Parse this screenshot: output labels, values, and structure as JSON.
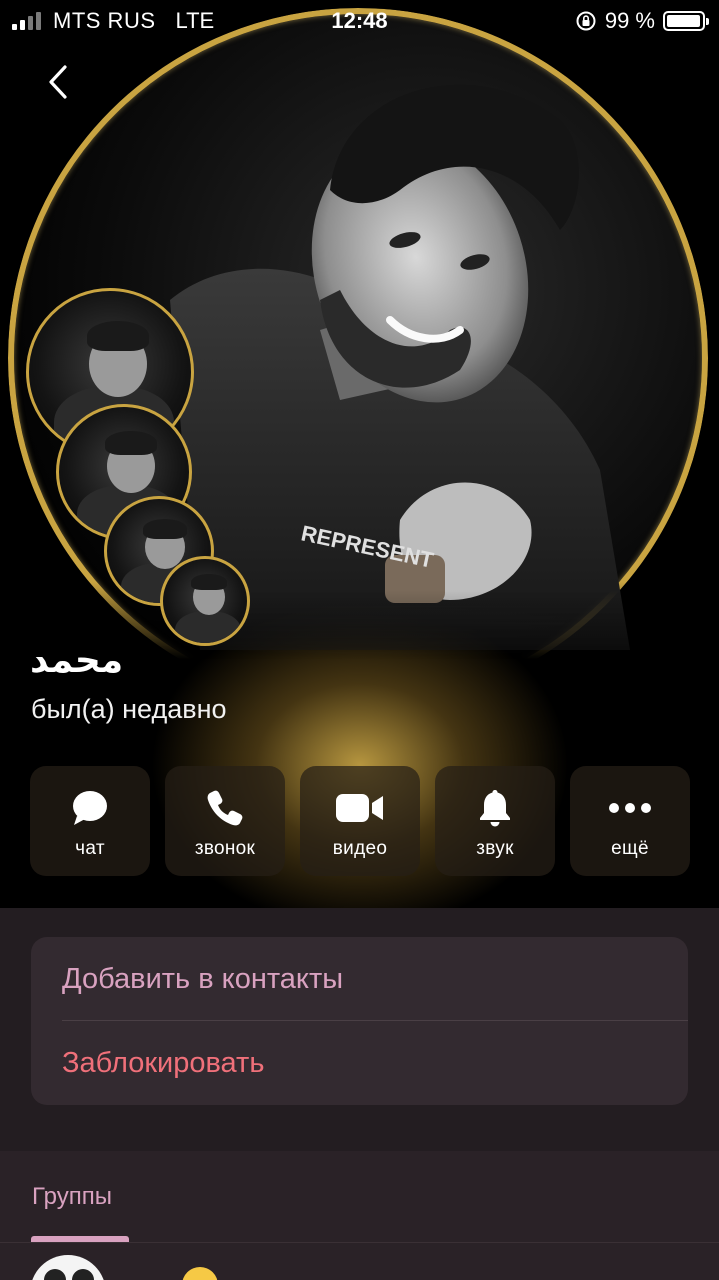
{
  "status_bar": {
    "carrier": "MTS RUS",
    "network": "LTE",
    "time": "12:48",
    "battery": "99 %",
    "battery_level": 0.99,
    "signal_bars": 4,
    "signal_bars_active": 2
  },
  "header": {
    "back_icon": "chevron-left-icon"
  },
  "profile": {
    "name": "محمد",
    "status": "был(а) недавно",
    "ring_color": "#c9a441"
  },
  "actions": [
    {
      "id": "chat",
      "label": "чат",
      "icon": "chat-bubble-icon"
    },
    {
      "id": "call",
      "label": "звонок",
      "icon": "phone-icon"
    },
    {
      "id": "video",
      "label": "видео",
      "icon": "video-camera-icon"
    },
    {
      "id": "sound",
      "label": "звук",
      "icon": "bell-icon"
    },
    {
      "id": "more",
      "label": "ещё",
      "icon": "more-dots-icon"
    }
  ],
  "menu": {
    "add_contact": "Добавить в контакты",
    "block": "Заблокировать"
  },
  "groups": {
    "title": "Группы"
  },
  "colors": {
    "accent": "#d9a2c0",
    "danger": "#f0707a",
    "panel": "#231d21",
    "card": "#332a30"
  }
}
